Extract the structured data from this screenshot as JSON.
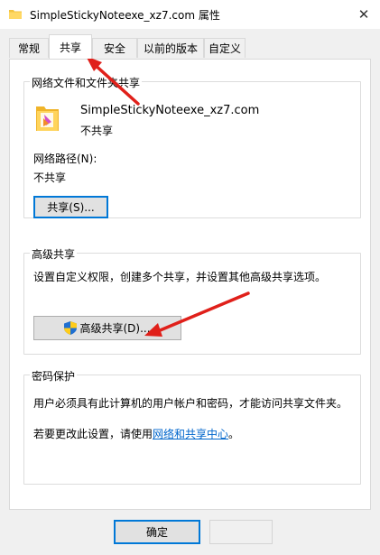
{
  "window": {
    "title": "SimpleStickyNoteexe_xz7.com 属性",
    "close_glyph": "✕"
  },
  "tabs": [
    {
      "label": "常规"
    },
    {
      "label": "共享"
    },
    {
      "label": "安全"
    },
    {
      "label": "以前的版本"
    },
    {
      "label": "自定义"
    }
  ],
  "network_sharing": {
    "group_title": "网络文件和文件夹共享",
    "item_name": "SimpleStickyNoteexe_xz7.com",
    "item_status": "不共享",
    "path_label": "网络路径(N):",
    "path_value": "不共享",
    "share_button": "共享(S)..."
  },
  "advanced_sharing": {
    "group_title": "高级共享",
    "description": "设置自定义权限，创建多个共享，并设置其他高级共享选项。",
    "button": "高级共享(D)..."
  },
  "password_protection": {
    "group_title": "密码保护",
    "description": "用户必须具有此计算机的用户帐户和密码，才能访问共享文件夹。",
    "change_prefix": "若要更改此设置，请使用",
    "change_link": "网络和共享中心",
    "change_suffix": "。"
  },
  "footer": {
    "ok_button": "确定"
  },
  "colors": {
    "accent": "#0078d7",
    "link": "#0066cc",
    "annotation_arrow": "#e0201a"
  }
}
